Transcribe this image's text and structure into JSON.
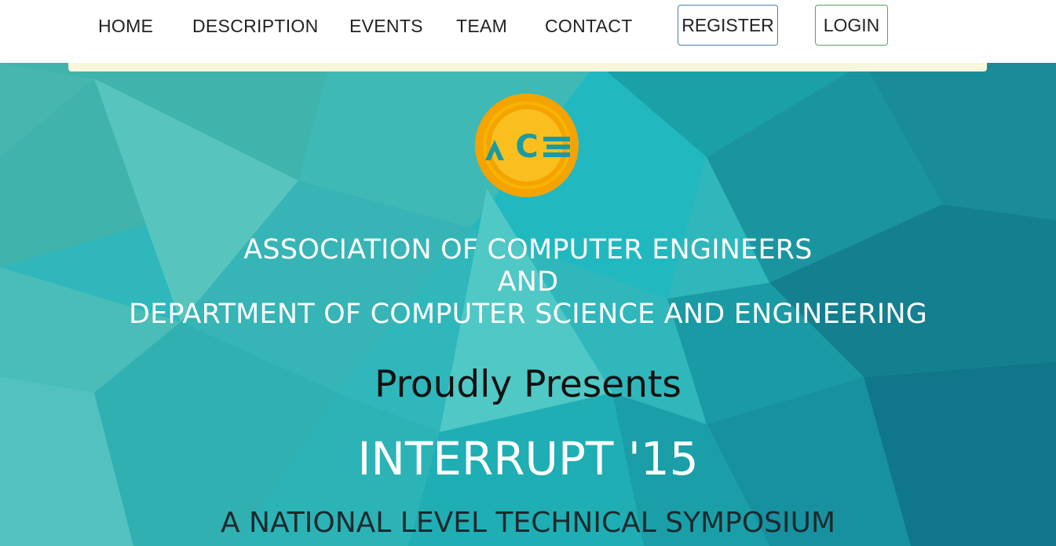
{
  "nav": {
    "links": [
      {
        "label": "HOME"
      },
      {
        "label": "DESCRIPTION"
      },
      {
        "label": "EVENTS"
      },
      {
        "label": "TEAM"
      },
      {
        "label": "CONTACT"
      }
    ],
    "register_label": "REGISTER",
    "login_label": "LOGIN"
  },
  "logo": {
    "icon": "ace-logo-icon",
    "text": "ACE",
    "ring_color": "#f5a300",
    "inner_color": "#f7b400"
  },
  "hero": {
    "org_line1": "ASSOCIATION OF COMPUTER ENGINEERS",
    "org_line2": "AND",
    "org_line3": "DEPARTMENT OF COMPUTER SCIENCE AND ENGINEERING",
    "presents": "Proudly Presents",
    "event_title": "INTERRUPT '15",
    "tagline": "A NATIONAL LEVEL TECHNICAL SYMPOSIUM",
    "background_color": "#2fb7bb"
  },
  "colors": {
    "register_border": "#4a7fb5",
    "login_border": "#5aa35a",
    "nav_strip": "#faf6dc"
  }
}
